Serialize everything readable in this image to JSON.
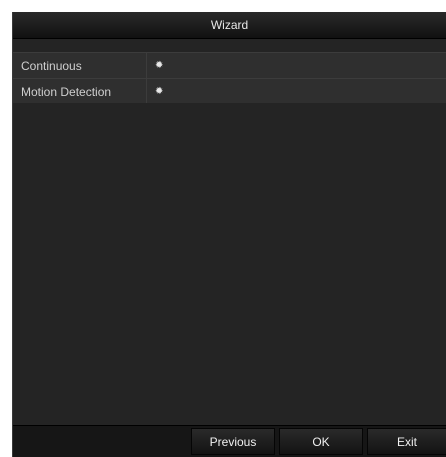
{
  "window": {
    "title": "Wizard"
  },
  "schedule_table": {
    "rows": [
      {
        "label": "Continuous",
        "icon": "gear-icon"
      },
      {
        "label": "Motion Detection",
        "icon": "gear-icon"
      }
    ]
  },
  "footer": {
    "previous_label": "Previous",
    "ok_label": "OK",
    "exit_label": "Exit"
  }
}
